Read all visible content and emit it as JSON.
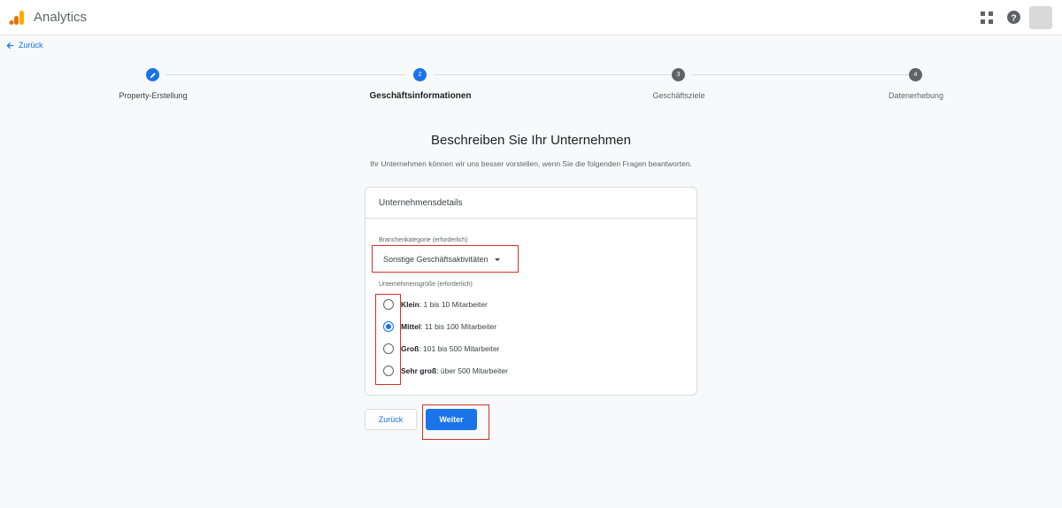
{
  "app": {
    "title": "Analytics"
  },
  "nav": {
    "back_label": "Zurück"
  },
  "steps": [
    {
      "number": "",
      "label": "Property-Erstellung",
      "state": "done"
    },
    {
      "number": "2",
      "label": "Geschäftsinformationen",
      "state": "current"
    },
    {
      "number": "3",
      "label": "Geschäftsziele",
      "state": "pending"
    },
    {
      "number": "4",
      "label": "Datenerhebung",
      "state": "pending"
    }
  ],
  "page": {
    "title": "Beschreiben Sie Ihr Unternehmen",
    "subtitle": "Ihr Unternehmen können wir uns besser vorstellen, wenn Sie die folgenden Fragen beantworten."
  },
  "card": {
    "header": "Unternehmensdetails",
    "industry": {
      "label": "Branchenkategorie (erforderlich)",
      "value": "Sonstige Geschäftsaktivitäten"
    },
    "size": {
      "label": "Unternehmensgröße (erforderlich)",
      "options": [
        {
          "name": "Klein",
          "desc": ": 1 bis 10 Mitarbeiter",
          "checked": false
        },
        {
          "name": "Mittel",
          "desc": ": 11 bis 100 Mitarbeiter",
          "checked": true
        },
        {
          "name": "Groß",
          "desc": ": 101 bis 500 Mitarbeiter",
          "checked": false
        },
        {
          "name": "Sehr groß",
          "desc": ": über 500 Mitarbeiter",
          "checked": false
        }
      ]
    }
  },
  "buttons": {
    "back": "Zurück",
    "next": "Weiter"
  },
  "colors": {
    "accent": "#1a73e8",
    "highlight": "#d93025"
  }
}
